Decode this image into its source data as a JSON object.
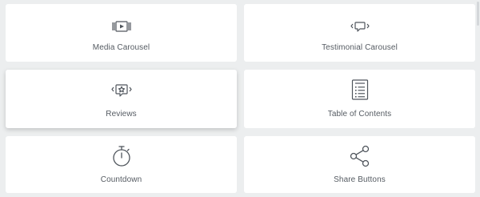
{
  "widgets": [
    {
      "label": "Media Carousel",
      "icon": "media-carousel-icon"
    },
    {
      "label": "Testimonial Carousel",
      "icon": "testimonial-carousel-icon"
    },
    {
      "label": "Reviews",
      "icon": "reviews-icon"
    },
    {
      "label": "Table of Contents",
      "icon": "table-of-contents-icon"
    },
    {
      "label": "Countdown",
      "icon": "countdown-icon"
    },
    {
      "label": "Share Buttons",
      "icon": "share-icon"
    }
  ],
  "colors": {
    "background": "#eceeef",
    "card": "#ffffff",
    "text": "#555b62",
    "icon": "#4f555c"
  }
}
